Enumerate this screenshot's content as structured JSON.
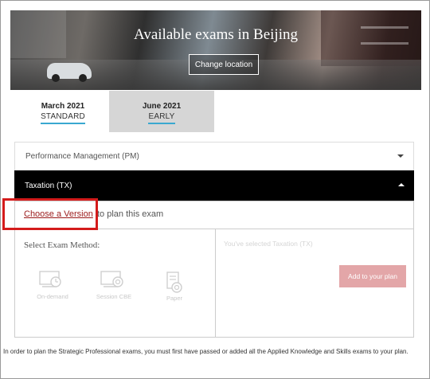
{
  "hero": {
    "title": "Available exams in Beijing",
    "change_button": "Change location"
  },
  "tabs": [
    {
      "month": "March 2021",
      "kind": "STANDARD",
      "active": true
    },
    {
      "month": "June 2021",
      "kind": "EARLY",
      "active": false
    }
  ],
  "accordion": {
    "items": [
      {
        "label": "Performance Management (PM)",
        "expanded": false
      },
      {
        "label": "Taxation (TX)",
        "expanded": true
      }
    ]
  },
  "panel": {
    "choose_link": "Choose a Version",
    "choose_rest": "to plan this exam",
    "method_title": "Select Exam Method:",
    "methods": [
      {
        "label": "On-demand",
        "icon": "on-demand-icon"
      },
      {
        "label": "Session CBE",
        "icon": "session-cbe-icon"
      },
      {
        "label": "Paper",
        "icon": "paper-icon"
      }
    ],
    "selected_text": "You've selected Taxation (TX)",
    "add_button": "Add to your plan"
  },
  "note": "In order to plan the Strategic Professional exams, you must first have passed or added all the Applied Knowledge and Skills exams to your plan.",
  "colors": {
    "active_underline": "#3aa8d0",
    "accordion_active_bg": "#000000",
    "link": "#9b1b1b",
    "add_button_bg": "#e3a6a8",
    "highlight_box": "#d41b1b"
  }
}
